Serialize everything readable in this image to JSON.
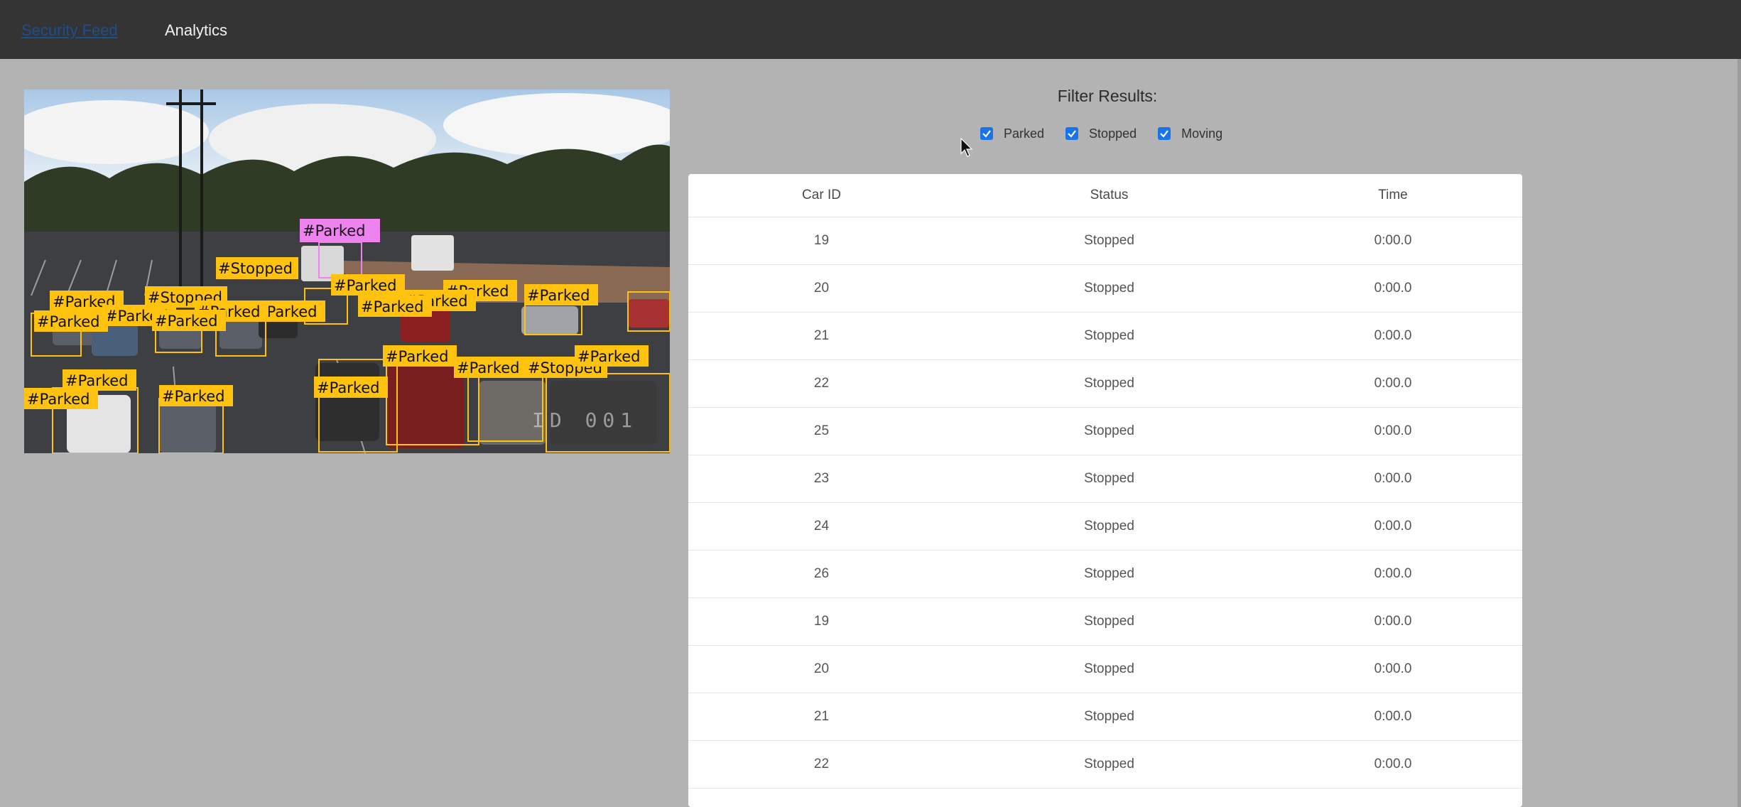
{
  "nav": {
    "security_feed": "Security Feed",
    "analytics": "Analytics"
  },
  "colors": {
    "topbar": "#343434",
    "page_bg": "#b3b3b3",
    "parked_box": "#ffc20e",
    "highlight_box": "#ee82ee",
    "checkbox": "#1a73e8"
  },
  "feed": {
    "labels": [
      "#Parked",
      "#Stopped",
      "#Parked",
      "#Parked",
      "#Parked",
      "#Stopped",
      "#Parked",
      "#Parked",
      "#Parked",
      "#Parked",
      "#Parked",
      "#Parked",
      "#Parked",
      "#Parked",
      "#Parked",
      "#Parked",
      "#Stopped",
      "#Parked",
      "#Parked",
      "#Parked",
      "#Parked",
      "#Parked"
    ],
    "overlay_text": "ID 001"
  },
  "filters": {
    "title": "Filter Results:",
    "options": [
      {
        "label": "Parked",
        "checked": true
      },
      {
        "label": "Stopped",
        "checked": true
      },
      {
        "label": "Moving",
        "checked": true
      }
    ]
  },
  "table": {
    "headers": [
      "Car ID",
      "Status",
      "Time"
    ],
    "rows": [
      {
        "id": "19",
        "status": "Stopped",
        "time": "0:00.0"
      },
      {
        "id": "20",
        "status": "Stopped",
        "time": "0:00.0"
      },
      {
        "id": "21",
        "status": "Stopped",
        "time": "0:00.0"
      },
      {
        "id": "22",
        "status": "Stopped",
        "time": "0:00.0"
      },
      {
        "id": "25",
        "status": "Stopped",
        "time": "0:00.0"
      },
      {
        "id": "23",
        "status": "Stopped",
        "time": "0:00.0"
      },
      {
        "id": "24",
        "status": "Stopped",
        "time": "0:00.0"
      },
      {
        "id": "26",
        "status": "Stopped",
        "time": "0:00.0"
      },
      {
        "id": "19",
        "status": "Stopped",
        "time": "0:00.0"
      },
      {
        "id": "20",
        "status": "Stopped",
        "time": "0:00.0"
      },
      {
        "id": "21",
        "status": "Stopped",
        "time": "0:00.0"
      },
      {
        "id": "22",
        "status": "Stopped",
        "time": "0:00.0"
      }
    ]
  }
}
